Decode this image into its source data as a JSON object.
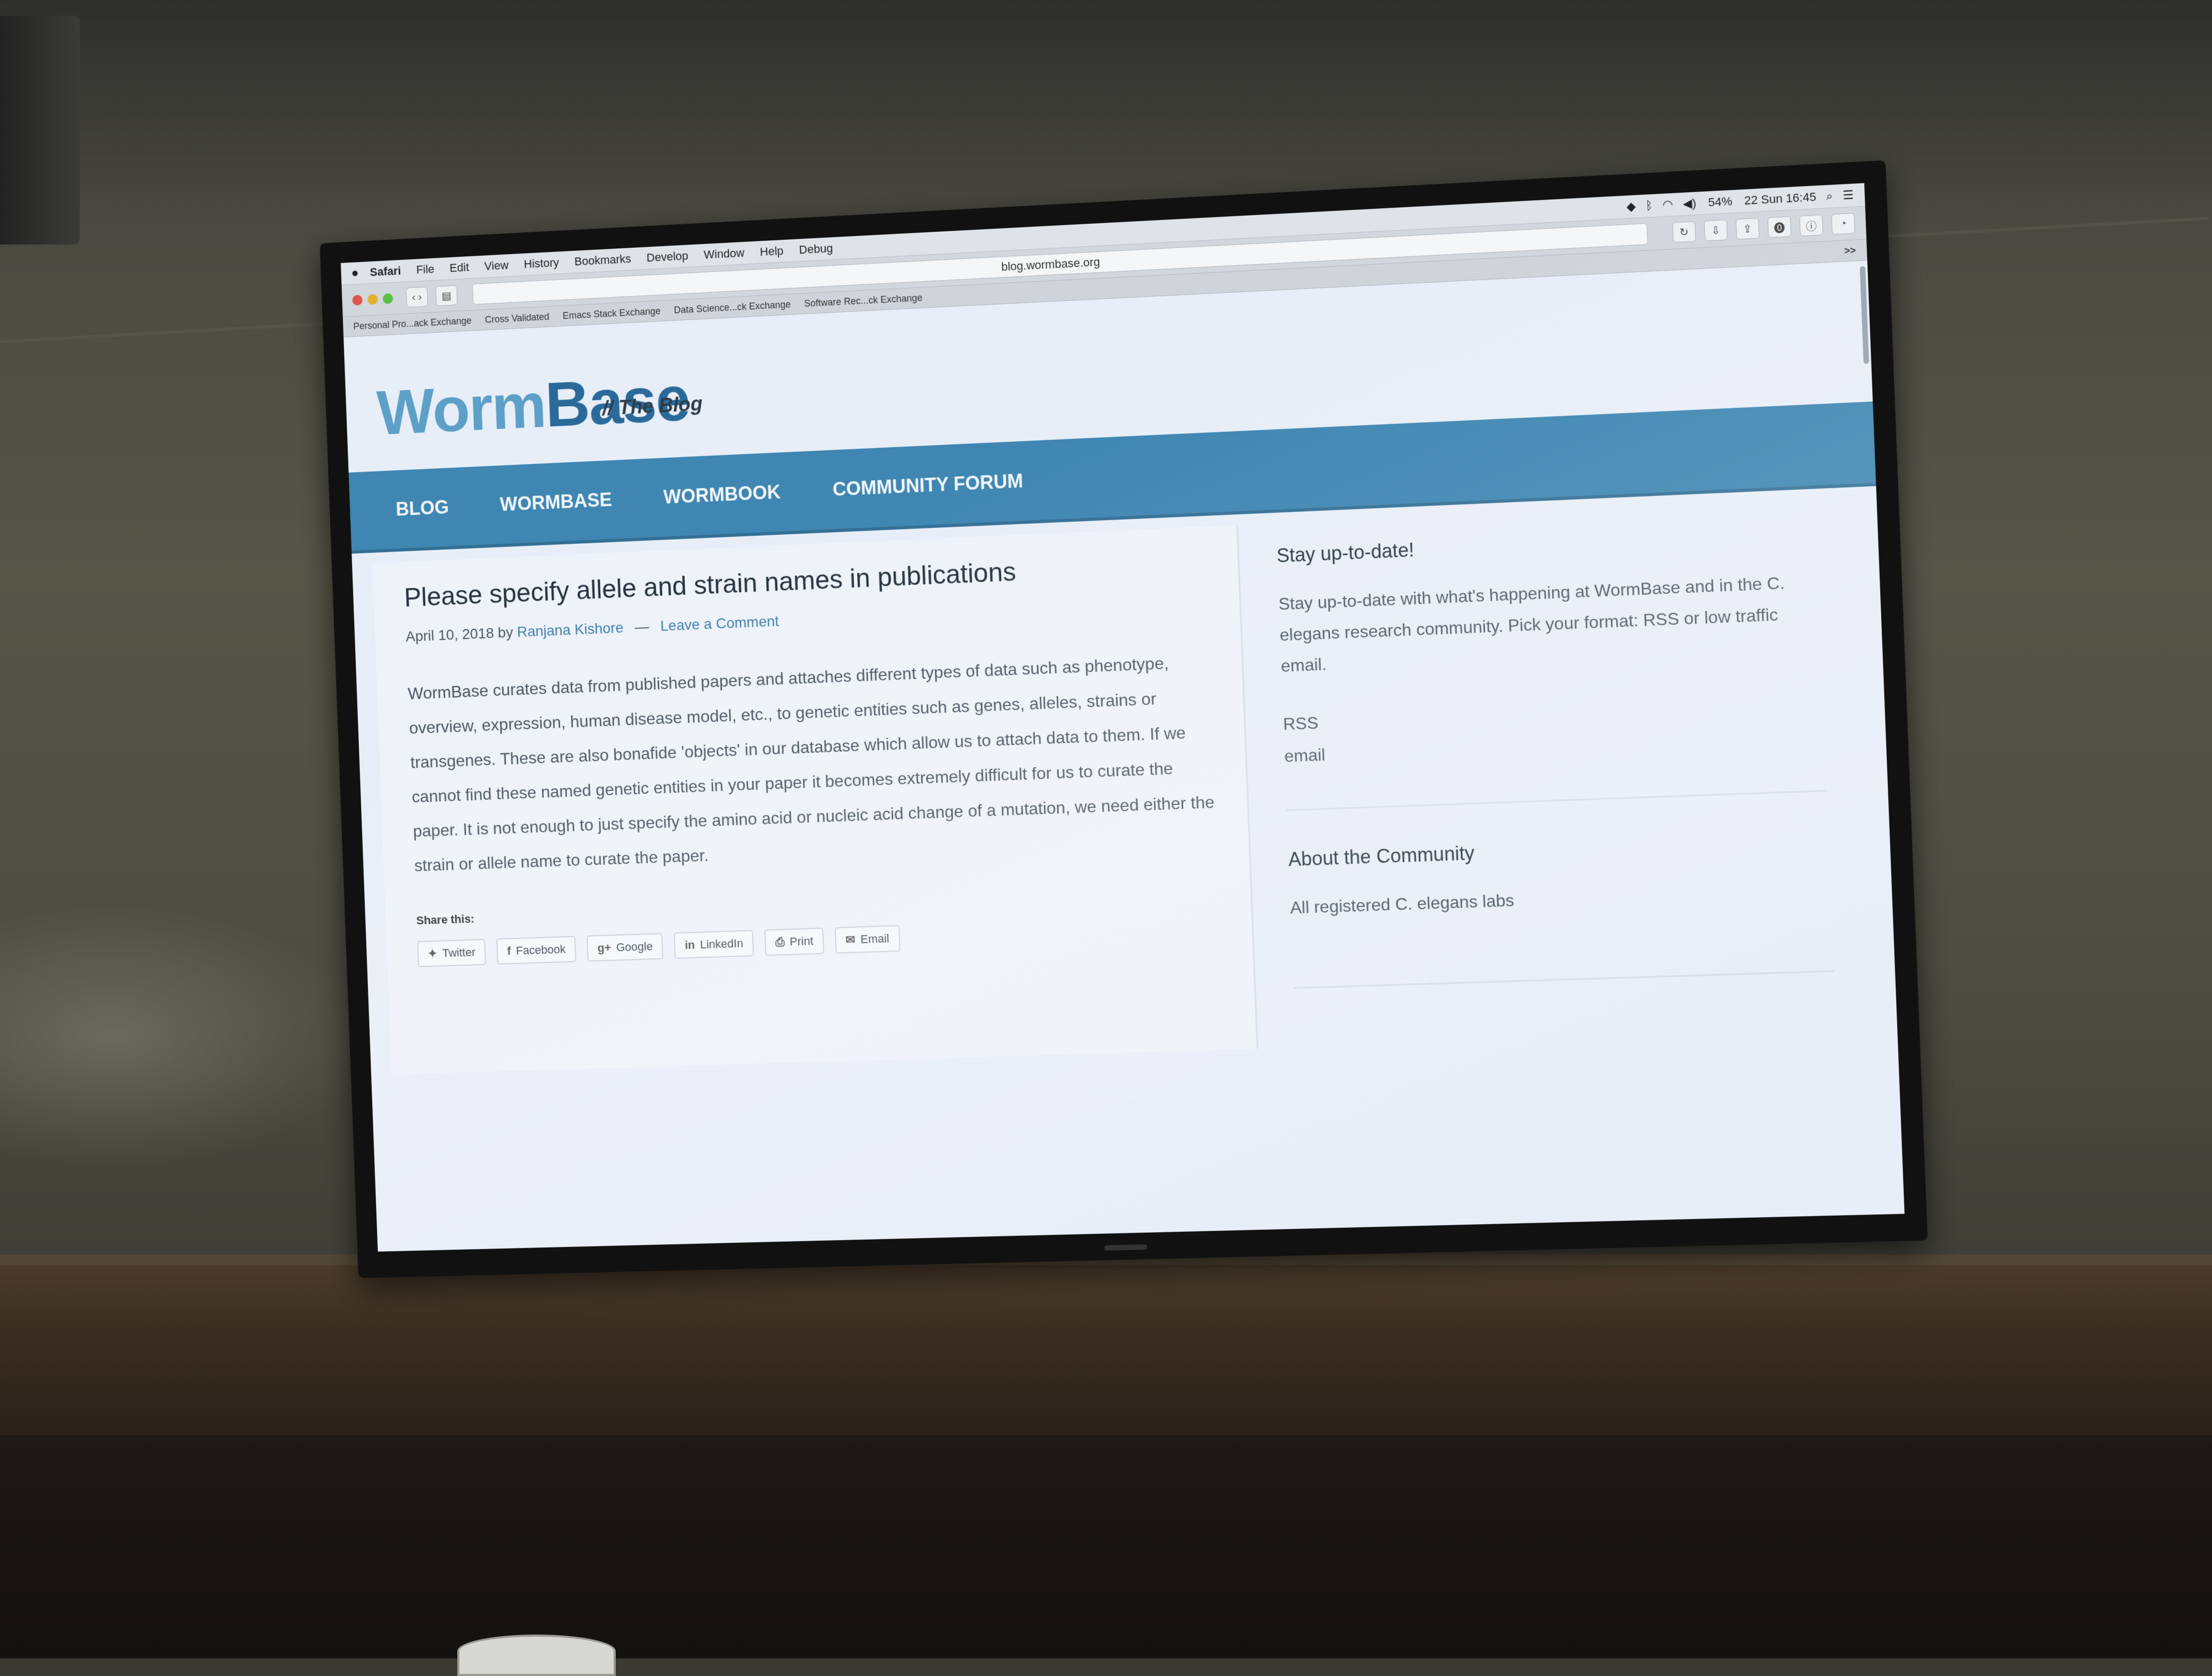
{
  "menubar": {
    "app": "Safari",
    "items": [
      "File",
      "Edit",
      "View",
      "History",
      "Bookmarks",
      "Develop",
      "Window",
      "Help",
      "Debug"
    ],
    "battery": "54%",
    "datetime": "22 Sun 16:45"
  },
  "toolbar": {
    "address": "blog.wormbase.org"
  },
  "favorites": [
    "Personal Pro...ack Exchange",
    "Cross Validated",
    "Emacs Stack Exchange",
    "Data Science...ck Exchange",
    "Software Rec...ck Exchange"
  ],
  "favorites_more": ">>",
  "site": {
    "logo_part1": "Worm",
    "logo_part2": "Base",
    "tagline": "// The Blog"
  },
  "nav": {
    "items": [
      "BLOG",
      "WORMBASE",
      "WORMBOOK",
      "COMMUNITY FORUM"
    ]
  },
  "post": {
    "title": "Please specify allele and strain names in publications",
    "date": "April 10, 2018",
    "by": "by",
    "author": "Ranjana Kishore",
    "separator": "—",
    "comment_link": "Leave a Comment",
    "body": "WormBase curates data from published papers and attaches different types of data such as phenotype, overview, expression, human disease model, etc., to genetic entities such as genes, alleles, strains or transgenes. These are also bonafide 'objects' in our database which allow us to attach data to them. If we cannot find these named genetic entities in your paper it becomes extremely difficult for us to curate the paper. It is not enough to just specify the amino acid or nucleic acid change of a mutation, we need either the strain or allele name to curate the paper.",
    "share_label": "Share this:",
    "share_buttons": [
      "Twitter",
      "Facebook",
      "Google",
      "LinkedIn",
      "Print",
      "Email"
    ]
  },
  "sidebar": {
    "stay_title": "Stay up-to-date!",
    "stay_text": "Stay up-to-date with what's happening at WormBase and in the C. elegans research community. Pick your format: RSS or low traffic email.",
    "links": [
      "RSS",
      "email"
    ],
    "about_title": "About the Community",
    "about_text": "All registered C. elegans labs"
  }
}
